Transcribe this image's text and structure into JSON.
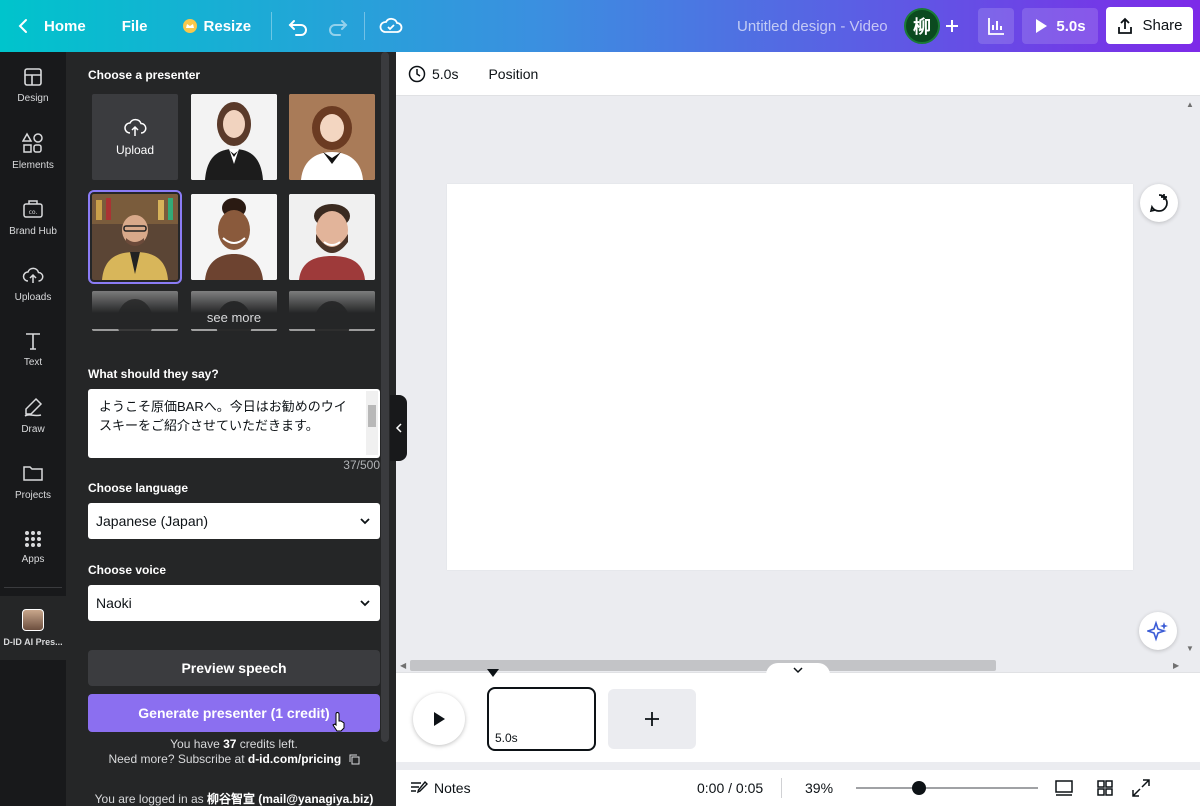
{
  "topbar": {
    "home": "Home",
    "file": "File",
    "resize": "Resize",
    "title": "Untitled design - Video",
    "avatar_initial": "柳",
    "duration": "5.0s",
    "share": "Share"
  },
  "rail": {
    "items": [
      {
        "label": "Design",
        "icon": "layout-icon"
      },
      {
        "label": "Elements",
        "icon": "shapes-icon"
      },
      {
        "label": "Brand Hub",
        "icon": "brand-icon"
      },
      {
        "label": "Uploads",
        "icon": "cloud-upload-icon"
      },
      {
        "label": "Text",
        "icon": "text-icon"
      },
      {
        "label": "Draw",
        "icon": "pen-icon"
      },
      {
        "label": "Projects",
        "icon": "folder-icon"
      },
      {
        "label": "Apps",
        "icon": "grid-icon"
      }
    ],
    "active_app": "D-ID AI Pres..."
  },
  "panel": {
    "choose_presenter": "Choose a presenter",
    "upload": "Upload",
    "see_more": "see more",
    "what_say": "What should they say?",
    "script_text": "ようこそ原価BARへ。今日はお勧めのウイスキーをご紹介させていただきます。",
    "counter": "37/500",
    "choose_language": "Choose language",
    "language_value": "Japanese (Japan)",
    "choose_voice": "Choose voice",
    "voice_value": "Naoki",
    "preview_button": "Preview speech",
    "generate_button": "Generate presenter (1 credit)",
    "credits_prefix": "You have ",
    "credits_count": "37",
    "credits_suffix": " credits left.",
    "need_more": "Need more? Subscribe at ",
    "pricing_link": "d-id.com/pricing",
    "logged_in_prefix": "You are logged in as ",
    "logged_in_user": "柳谷智宣 (mail@yanagiya.biz)"
  },
  "context_bar": {
    "duration": "5.0s",
    "position": "Position"
  },
  "timeline": {
    "clip_duration": "5.0s"
  },
  "footer": {
    "notes": "Notes",
    "time": "0:00 / 0:05",
    "zoom": "39%",
    "zoom_level": 0.39
  },
  "colors": {
    "accent": "#8b6ff0",
    "gradient_start": "#00c4cc",
    "gradient_end": "#7d2ae8",
    "rail_bg": "#18191b",
    "panel_bg": "#252627"
  }
}
